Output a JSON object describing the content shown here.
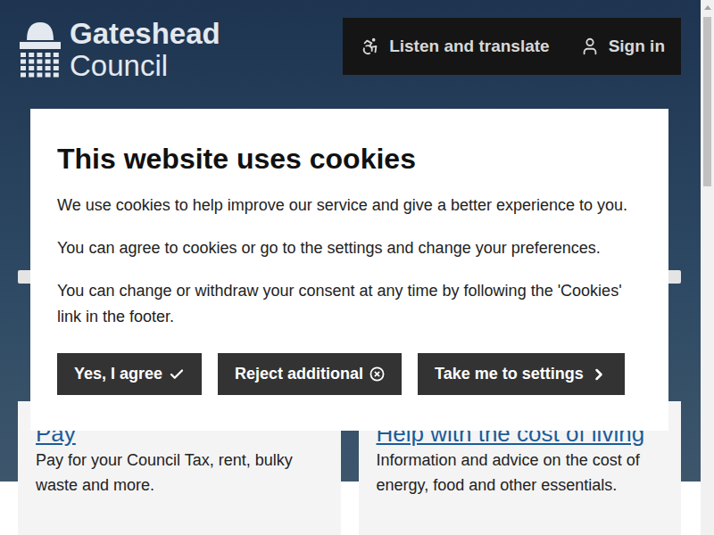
{
  "header": {
    "logo": {
      "line1": "Gateshead",
      "line2": "Council"
    },
    "actions": [
      {
        "label": "Listen and translate",
        "kind": "listen"
      },
      {
        "label": "Sign in",
        "kind": "signin"
      }
    ]
  },
  "cards": [
    {
      "title": "Pay",
      "lines": [
        "Pay for your Council Tax, rent, bulky",
        "waste and more."
      ]
    },
    {
      "title": "Help with the cost of living",
      "lines": [
        "Information and advice on the cost of",
        "energy, food and other essentials."
      ]
    }
  ],
  "cookie_dialog": {
    "title": "This website uses cookies",
    "paragraphs": [
      "We use cookies to help improve our service and give a better experience to you.",
      "You can agree to cookies or go to the settings and change your preferences.",
      "You can change or withdraw your consent at any time by following the 'Cookies' link in the footer."
    ],
    "buttons": [
      {
        "label": "Yes, I agree",
        "kind": "agree"
      },
      {
        "label": "Reject additional",
        "kind": "reject"
      },
      {
        "label": "Take me to settings",
        "kind": "settings"
      }
    ]
  }
}
